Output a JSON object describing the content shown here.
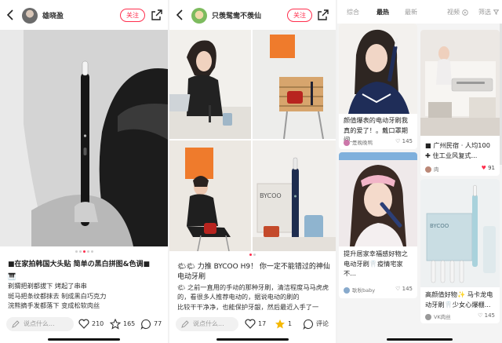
{
  "note1": {
    "username": "雄晓盈",
    "follow_label": "关注",
    "title": "■在家拍韩国大头贴 简单の黑白拼图&色调■",
    "body_lines": [
      "🎹",
      "剃猬把剃都拔下 烤起了串串",
      "斑马把条纹都抹去 制成黑白巧克力",
      "浣熊摘手发都落下 变成松软肉丝"
    ],
    "comment_placeholder": "说点什么...",
    "likes": "210",
    "stars": "165",
    "comments": "77",
    "photo_dots": 5,
    "active_dot": 2
  },
  "note2": {
    "username": "只羡鸳鸯不羡仙",
    "follow_label": "关注",
    "title": "🌤🌤 力推 BYCOO H9！ 你一定不能错过的神仙电动牙刷",
    "body_lines": [
      "🌤 之前一直用的手动的那种牙刷，清洁程度马马虎虎的，看很多人推荐电动的，据说电动的刷的",
      "比较干干净净，也能保护牙龈，然后最近入手了一"
    ],
    "comment_placeholder": "说点什么...",
    "likes": "17",
    "stars": "1",
    "comment_label": "评论",
    "brand_text": "BYCOO",
    "photo_dots": 2,
    "active_dot": 0
  },
  "feed": {
    "tabs": [
      "综合",
      "最热",
      "最新",
      "视频",
      "筛选"
    ],
    "active_tab": 1,
    "cards": [
      {
        "title": "颜值爆表的电动牙刷我真的爱了！。戴口罩期间...",
        "user": "是晚晚鸭",
        "likes": "145"
      },
      {
        "title": "提升居家幸福感好物之电动牙刷🦷疫情宅家 不...",
        "user": "耿秋baby",
        "likes": "145"
      },
      {
        "title": "■ 广州民宿 · 人均100 ✚ 住工业风复式...",
        "user": "肉",
        "likes": "91"
      },
      {
        "title": "高颜值好物✨ 马卡龙电动牙刷🦷少女心爆棚...",
        "user": "VK肉丝",
        "likes": "145"
      }
    ],
    "brand_text": "BYCOO"
  },
  "colors": {
    "accent": "#ff2e4d",
    "star": "#f5b800"
  }
}
